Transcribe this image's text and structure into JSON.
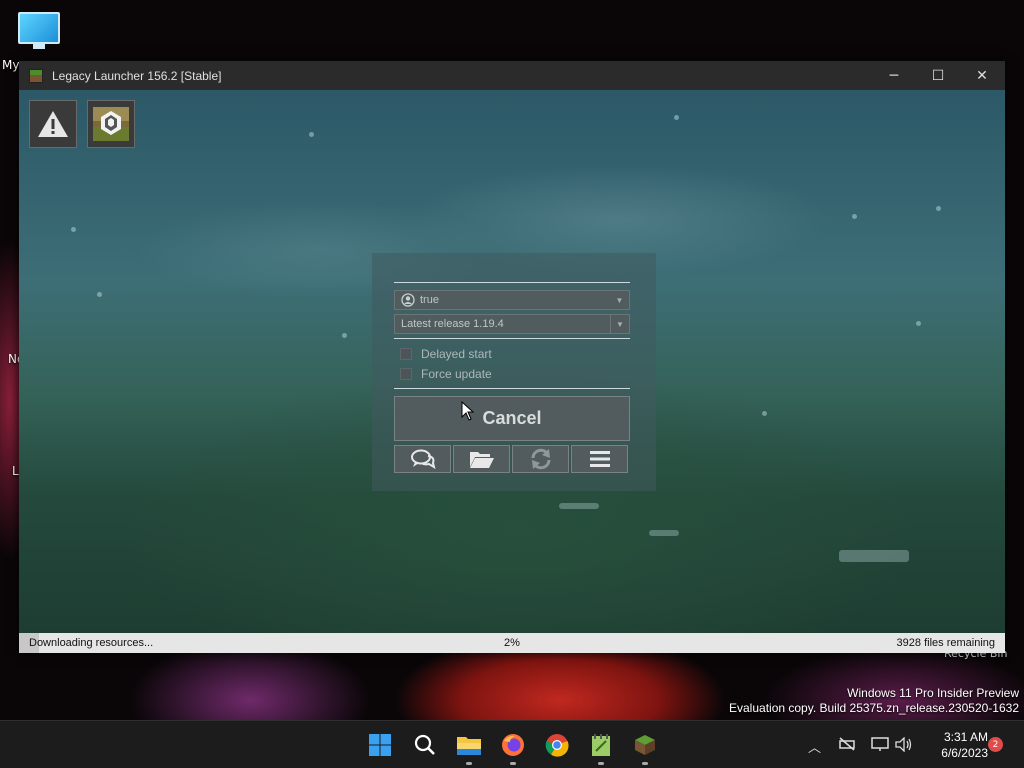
{
  "desktop": {
    "icons": [
      {
        "label": "My",
        "icon": "this-pc-icon"
      },
      {
        "label": "No",
        "icon": "notepad-icon"
      },
      {
        "label": "L",
        "icon": "launcher-icon"
      }
    ],
    "recycle_bin_label": "Recycle Bin",
    "watermark_line1": "Windows 11 Pro Insider Preview",
    "watermark_line2": "Evaluation copy. Build 25375.zn_release.230520-1632"
  },
  "window": {
    "title": "Legacy Launcher 156.2 [Stable]",
    "controls": {
      "minimize": "─",
      "maximize": "☐",
      "close": "✕"
    }
  },
  "launcher": {
    "corner_buttons": [
      "warning-icon",
      "tl-logo-icon"
    ],
    "account": "true",
    "version": "Latest release 1.19.4",
    "checkboxes": [
      {
        "label": "Delayed start",
        "checked": false
      },
      {
        "label": "Force update",
        "checked": false
      }
    ],
    "cancel_label": "Cancel",
    "tools": [
      "chat-icon",
      "folder-icon",
      "refresh-icon",
      "menu-icon"
    ]
  },
  "status": {
    "text": "Downloading resources...",
    "percent": "2%",
    "progress": 0.02,
    "remaining": "3928 files remaining"
  },
  "taskbar": {
    "apps": [
      "windows-start-icon",
      "search-icon",
      "file-explorer-icon",
      "firefox-icon",
      "chrome-icon",
      "notepad-plus-icon",
      "legacy-launcher-icon"
    ],
    "tray": [
      "chevron-up-icon",
      "network-off-icon",
      "display-icon",
      "volume-icon"
    ],
    "time": "3:31 AM",
    "date": "6/6/2023",
    "notifications": "2"
  }
}
